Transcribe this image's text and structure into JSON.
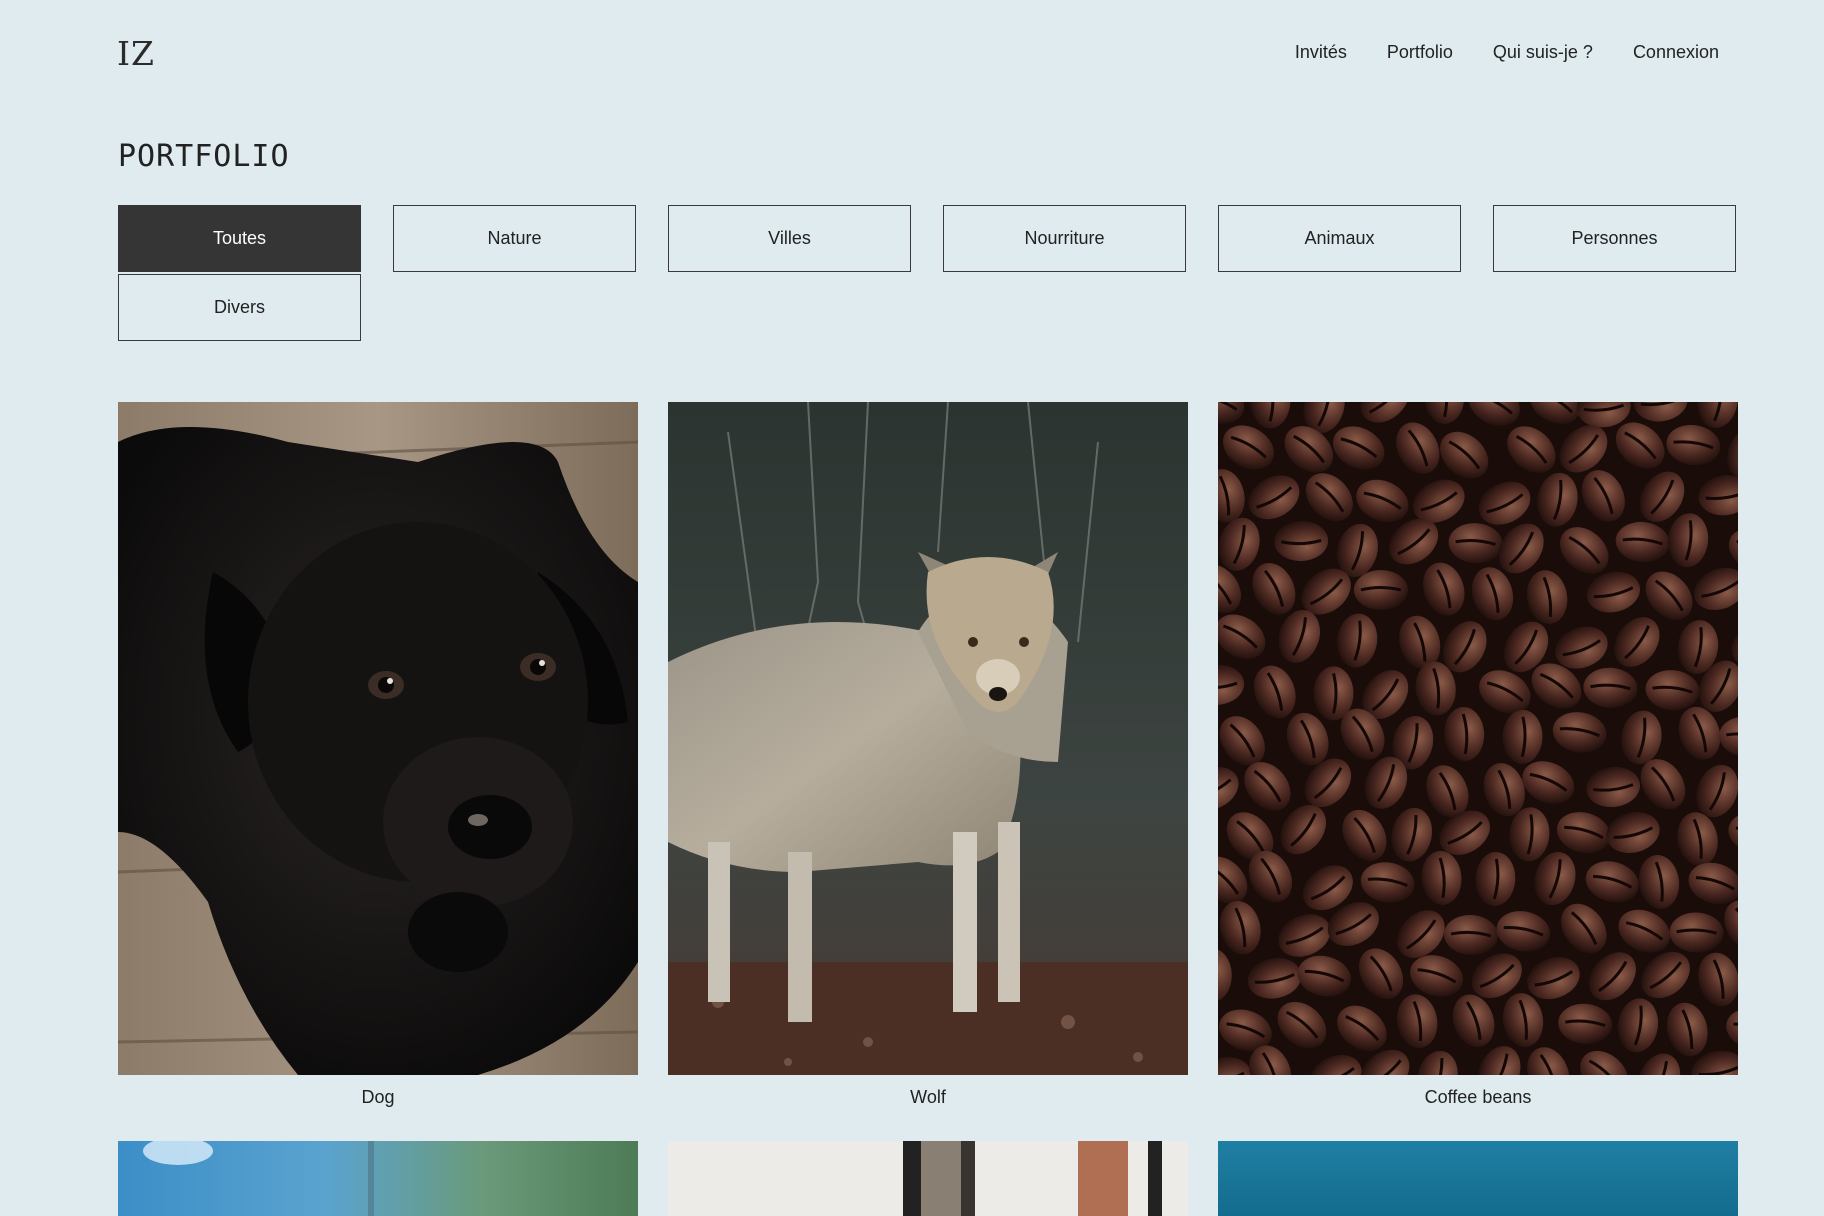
{
  "header": {
    "logo": "IZ",
    "nav": [
      "Invités",
      "Portfolio",
      "Qui suis-je ?",
      "Connexion"
    ]
  },
  "main": {
    "title": "PORTFOLIO",
    "filters": [
      "Toutes",
      "Nature",
      "Villes",
      "Nourriture",
      "Animaux",
      "Personnes",
      "Divers"
    ],
    "active_filter": "Toutes",
    "gallery": [
      {
        "caption": "Dog"
      },
      {
        "caption": "Wolf"
      },
      {
        "caption": "Coffee beans"
      }
    ]
  },
  "colors": {
    "background": "#dfebef",
    "active_button": "#353535",
    "text": "#222222"
  }
}
